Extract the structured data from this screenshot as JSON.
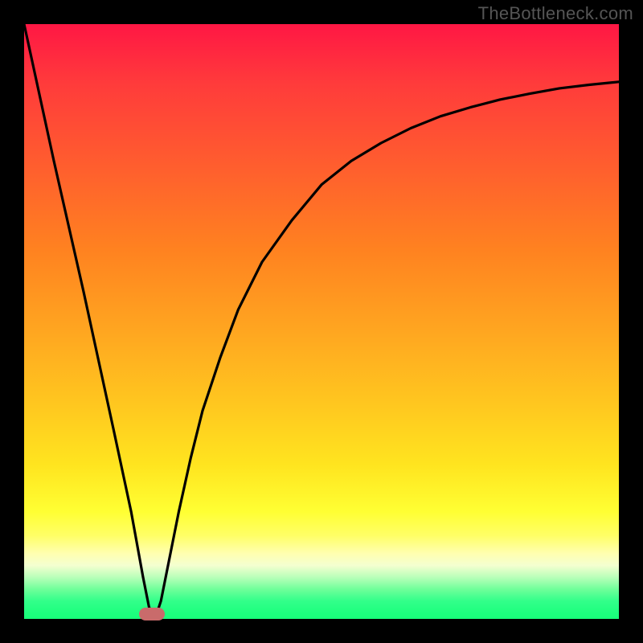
{
  "watermark": "TheBottleneck.com",
  "chart_data": {
    "type": "line",
    "title": "",
    "xlabel": "",
    "ylabel": "",
    "xlim": [
      0,
      100
    ],
    "ylim": [
      0,
      100
    ],
    "series": [
      {
        "name": "left-branch",
        "x": [
          0,
          5,
          10,
          15,
          18,
          20,
          21,
          22
        ],
        "values": [
          100,
          77,
          55,
          32,
          18,
          7,
          2,
          0
        ]
      },
      {
        "name": "right-branch",
        "x": [
          22,
          23,
          24,
          26,
          28,
          30,
          33,
          36,
          40,
          45,
          50,
          55,
          60,
          65,
          70,
          75,
          80,
          85,
          90,
          95,
          100
        ],
        "values": [
          0,
          3,
          8,
          18,
          27,
          35,
          44,
          52,
          60,
          67,
          73,
          77,
          80,
          82.5,
          84.5,
          86,
          87.3,
          88.3,
          89.2,
          89.8,
          90.3
        ]
      }
    ],
    "marker": {
      "x": 21.5,
      "y": 0.8
    },
    "gradient_stops": [
      {
        "pos": 0,
        "color": "#ff1744"
      },
      {
        "pos": 50,
        "color": "#ffb020"
      },
      {
        "pos": 82,
        "color": "#ffff33"
      },
      {
        "pos": 100,
        "color": "#18ff7a"
      }
    ]
  }
}
